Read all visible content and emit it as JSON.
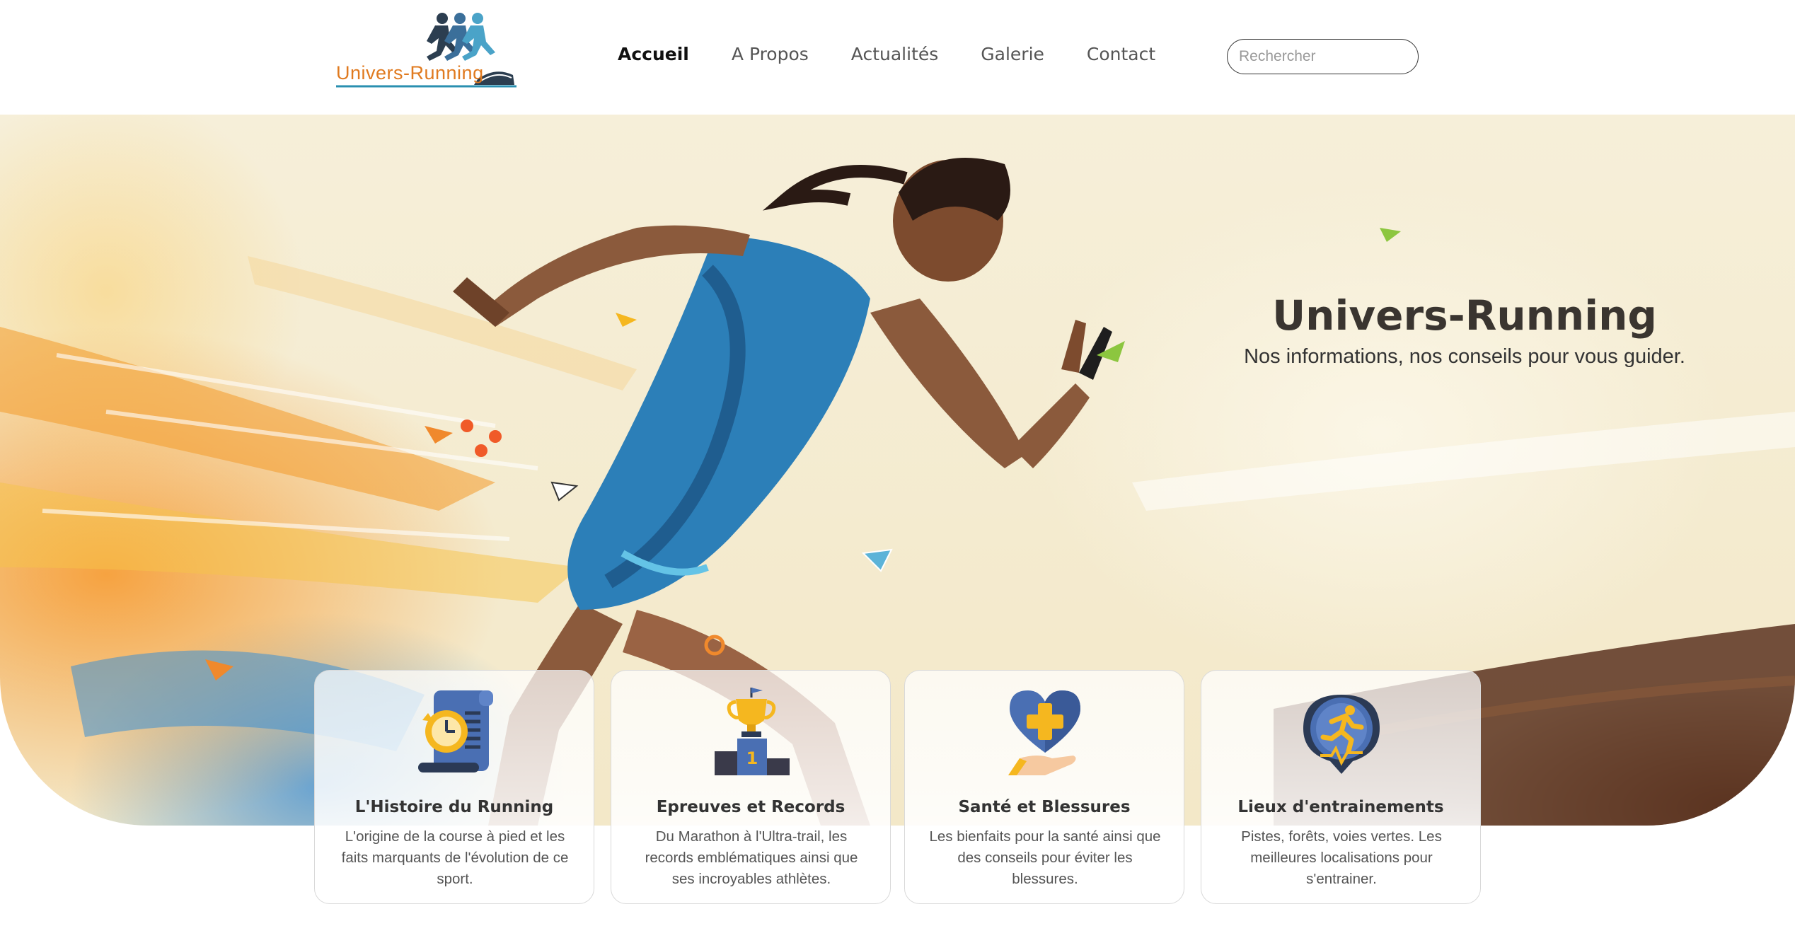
{
  "brand": {
    "logo_text": "Univers-Running"
  },
  "nav": {
    "items": [
      {
        "label": "Accueil",
        "active": true
      },
      {
        "label": "A Propos",
        "active": false
      },
      {
        "label": "Actualités",
        "active": false
      },
      {
        "label": "Galerie",
        "active": false
      },
      {
        "label": "Contact",
        "active": false
      }
    ]
  },
  "search": {
    "placeholder": "Rechercher",
    "value": "",
    "icon": "search-icon"
  },
  "hero": {
    "title": "Univers-Running",
    "subtitle": "Nos informations, nos conseils pour vous guider."
  },
  "cards": [
    {
      "title": "L'Histoire du Running",
      "description": "L'origine de la course à pied et les faits marquants de l'évolution de ce sport.",
      "icon": "history-scroll-icon"
    },
    {
      "title": "Epreuves et Records",
      "description": "Du Marathon à l'Ultra-trail, les records emblématiques ainsi que ses incroyables athlètes.",
      "icon": "trophy-podium-icon"
    },
    {
      "title": "Santé et Blessures",
      "description": "Les bienfaits pour la santé ainsi que des conseils pour éviter les blessures.",
      "icon": "health-heart-icon"
    },
    {
      "title": "Lieux d'entrainements",
      "description": "Pistes, forêts, voies vertes. Les meilleures localisations pour s'entrainer.",
      "icon": "runner-location-icon"
    }
  ],
  "colors": {
    "accent_orange": "#e07a1f",
    "icon_blue": "#4a6fb3",
    "icon_yellow": "#f5b71f",
    "nav_active": "#111111",
    "text_dark": "#333333"
  }
}
